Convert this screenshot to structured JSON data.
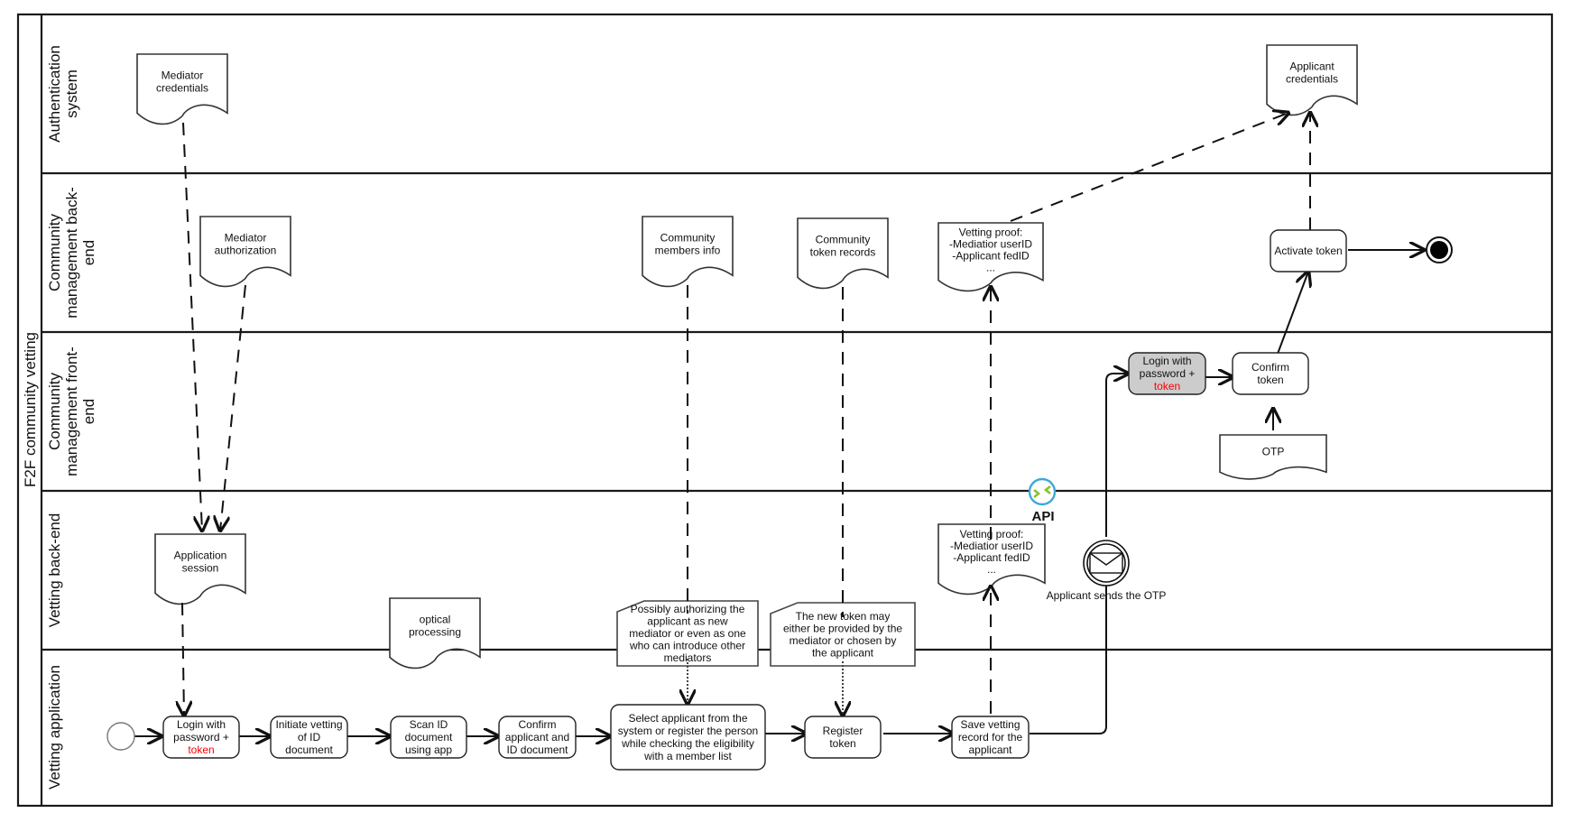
{
  "pool": {
    "title": "F2F community vetting"
  },
  "lanes": [
    {
      "id": "auth",
      "lines": [
        "Authentication",
        "system"
      ]
    },
    {
      "id": "cm_backend",
      "lines": [
        "Community",
        "management back-",
        "end"
      ]
    },
    {
      "id": "cm_frontend",
      "lines": [
        "Community",
        "management front-",
        "end"
      ]
    },
    {
      "id": "vet_backend",
      "lines": [
        "Vetting back-end"
      ]
    },
    {
      "id": "vet_app",
      "lines": [
        "Vetting application"
      ]
    }
  ],
  "documents": {
    "mediator_credentials": [
      "Mediator",
      "credentials"
    ],
    "applicant_credentials": [
      "Applicant",
      "credentials"
    ],
    "mediator_authorization": [
      "Mediator",
      "authorization"
    ],
    "community_members_info": [
      "Community",
      "members info"
    ],
    "community_token_records": [
      "Community",
      "token records"
    ],
    "vetting_proof_backend": [
      "Vetting proof:",
      "-Mediatior userID",
      "-Applicant fedID",
      "..."
    ],
    "otp": [
      "OTP"
    ],
    "application_session": [
      "Application",
      "session"
    ],
    "vetting_proof_vetting": [
      "Vetting proof:",
      "-Mediatior userID",
      "-Applicant fedID",
      "..."
    ],
    "optical_processing": [
      "optical",
      "processing"
    ]
  },
  "tasks": {
    "login_app": {
      "lines": [
        "Login with",
        "password +"
      ],
      "highlight": "token"
    },
    "initiate_vetting": {
      "lines": [
        "Initiate vetting",
        "of  ID",
        "document"
      ]
    },
    "scan_id": {
      "lines": [
        "Scan ID",
        "document",
        "using app"
      ]
    },
    "confirm_applicant": {
      "lines": [
        "Confirm",
        "applicant and",
        "ID document"
      ]
    },
    "select_applicant": {
      "lines": [
        "Select applicant from the",
        "system or register the person",
        "while checking the eligibility",
        "with a member list"
      ]
    },
    "register_token": {
      "lines": [
        "Register",
        "token"
      ]
    },
    "save_vetting": {
      "lines": [
        "Save vetting",
        "record for the",
        "applicant"
      ]
    },
    "login_frontend": {
      "lines": [
        "Login with",
        "password +"
      ],
      "highlight": "token"
    },
    "confirm_token": {
      "lines": [
        "Confirm",
        "token"
      ]
    },
    "activate_token": {
      "lines": [
        "Activate token"
      ]
    }
  },
  "notes": {
    "authorizing_note": [
      "Possibly authorizing the",
      "applicant as new",
      "mediator or even as one",
      "who can introduce other",
      "mediators"
    ],
    "token_note": [
      "The new token may",
      "either be provided by the",
      "mediator or chosen by",
      "the applicant"
    ]
  },
  "events": {
    "message_event_label": "Applicant sends the OTP"
  },
  "api": {
    "label": "API"
  },
  "colors": {
    "highlight_text": "#ff0000",
    "grey_task": "#cccccc",
    "api_ring": "#3fa9d6",
    "api_arrows": "#8cc22a"
  }
}
